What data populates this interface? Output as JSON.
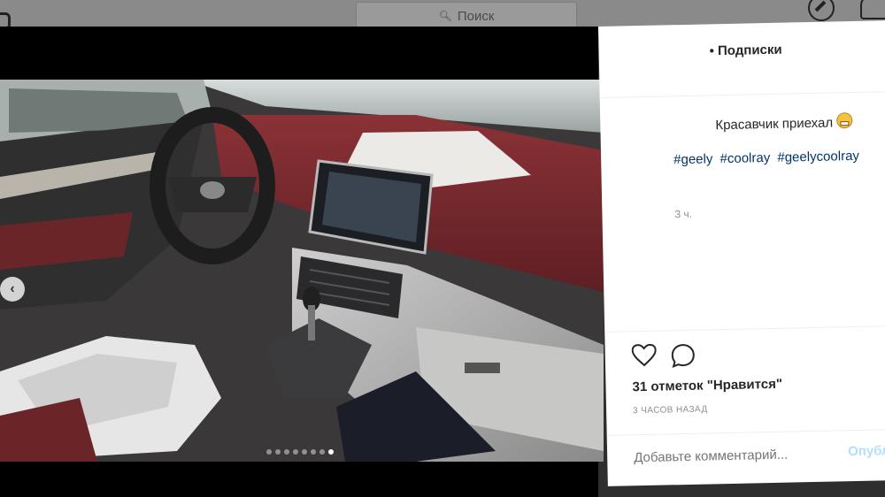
{
  "search": {
    "placeholder": "Поиск",
    "icon": "search-icon"
  },
  "post": {
    "follow_label": "• Подписки",
    "caption": "Красавчик приехал",
    "caption_emoji": "grimacing-emoji",
    "hashtags": [
      "#geely",
      "#coolray",
      "#geelycoolray"
    ],
    "time_short": "3 ч.",
    "likes": "31 отметок \"Нравится\"",
    "time_ago": "3 ЧАСОВ НАЗАД"
  },
  "comment": {
    "placeholder": "Добавьте комментарий...",
    "publish_label": "Опубли"
  },
  "carousel": {
    "total": 8,
    "active": 8
  },
  "colors": {
    "hashtag": "#003569",
    "publish": "#b2dffc",
    "muted": "#8e8e8e",
    "dashboard_red": "#7a2b2e"
  }
}
